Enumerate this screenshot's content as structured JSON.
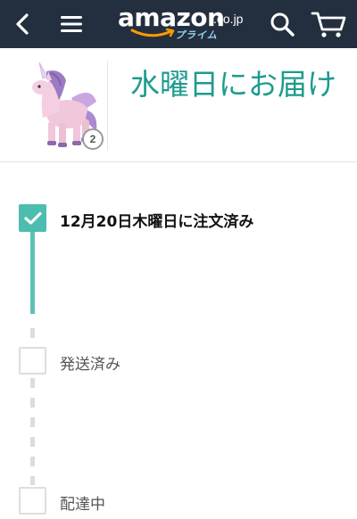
{
  "header": {
    "logo_word": "amazon",
    "logo_tld": ".co.jp",
    "logo_prime": "プライム",
    "icons": {
      "back": "chevron-left-icon",
      "menu": "hamburger-menu-icon",
      "search": "search-icon",
      "cart": "cart-icon"
    },
    "colors": {
      "bar": "#232f3e",
      "smile": "#ff9900",
      "prime": "#8fd3f4"
    }
  },
  "order": {
    "delivery_title": "水曜日にお届け",
    "item_quantity": "2"
  },
  "timeline": {
    "steps": [
      {
        "label": "12月20日木曜日に注文済み",
        "status": "done"
      },
      {
        "label": "発送済み",
        "status": "pending"
      },
      {
        "label": "配達中",
        "status": "pending"
      }
    ],
    "colors": {
      "done": "#4dbdb0",
      "pending": "#dedede",
      "accent": "#1d9b8e"
    }
  }
}
